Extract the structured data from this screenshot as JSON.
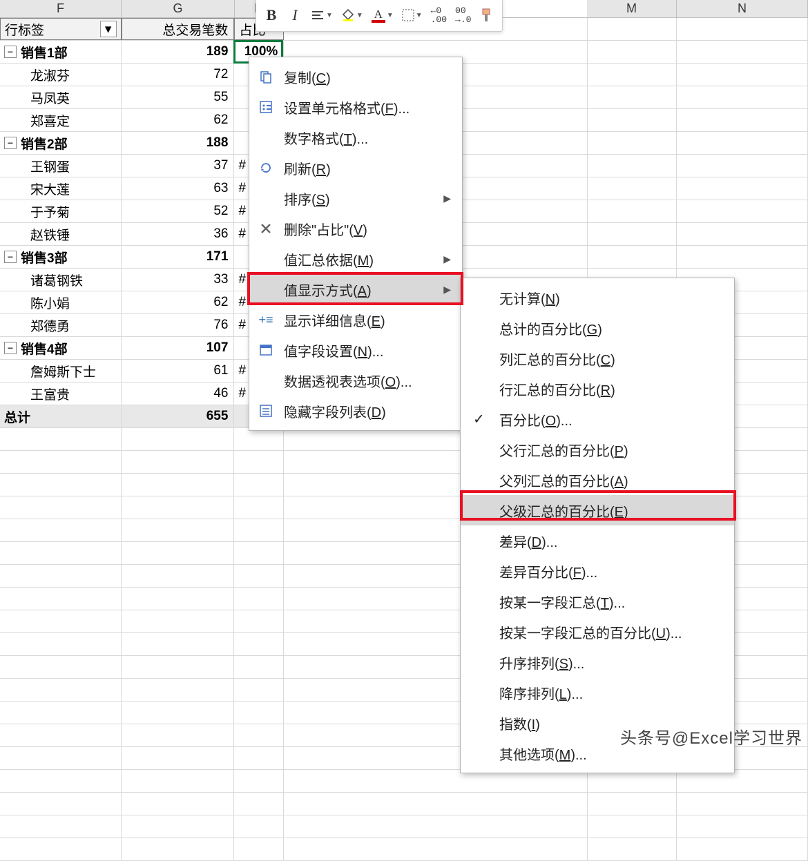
{
  "columns": [
    "F",
    "G",
    "H",
    "",
    "",
    "",
    "",
    "M",
    "N"
  ],
  "pivot": {
    "headers": {
      "rowlabel": "行标签",
      "col1": "总交易笔数",
      "col2": "占比"
    },
    "active_value": "100%",
    "groups": [
      {
        "name": "销售1部",
        "total": 189,
        "items": [
          {
            "name": "龙淑芬",
            "value": 72
          },
          {
            "name": "马凤英",
            "value": 55
          },
          {
            "name": "郑喜定",
            "value": 62
          }
        ]
      },
      {
        "name": "销售2部",
        "total": 188,
        "items": [
          {
            "name": "王钢蛋",
            "value": 37,
            "trunc": "#"
          },
          {
            "name": "宋大莲",
            "value": 63,
            "trunc": "#"
          },
          {
            "name": "于予菊",
            "value": 52,
            "trunc": "#"
          },
          {
            "name": "赵铁锤",
            "value": 36,
            "trunc": "#"
          }
        ]
      },
      {
        "name": "销售3部",
        "total": 171,
        "items": [
          {
            "name": "诸葛钢铁",
            "value": 33,
            "trunc": "#"
          },
          {
            "name": "陈小娟",
            "value": 62,
            "trunc": "#"
          },
          {
            "name": "郑德勇",
            "value": 76,
            "trunc": "#"
          }
        ]
      },
      {
        "name": "销售4部",
        "total": 107,
        "items": [
          {
            "name": "詹姆斯下士",
            "value": 61,
            "trunc": "#"
          },
          {
            "name": "王富贵",
            "value": 46,
            "trunc": "#"
          }
        ]
      }
    ],
    "grand": {
      "label": "总计",
      "value": 655
    }
  },
  "toolbar": {
    "bold": "B",
    "italic": "I"
  },
  "context_menu": {
    "copy": "复制(C)",
    "format_cells": "设置单元格格式(F)...",
    "number_format": "数字格式(T)...",
    "refresh": "刷新(R)",
    "sort": "排序(S)",
    "delete": "删除\"占比\"(V)",
    "summarize": "值汇总依据(M)",
    "show_as": "值显示方式(A)",
    "details": "显示详细信息(E)",
    "field_settings": "值字段设置(N)...",
    "pivot_options": "数据透视表选项(O)...",
    "hide_list": "隐藏字段列表(D)"
  },
  "submenu": {
    "no_calc": "无计算(N)",
    "grand_pct": "总计的百分比(G)",
    "col_pct": "列汇总的百分比(C)",
    "row_pct": "行汇总的百分比(R)",
    "pct": "百分比(O)...",
    "parent_row_pct": "父行汇总的百分比(P)",
    "parent_col_pct": "父列汇总的百分比(A)",
    "parent_pct": "父级汇总的百分比(E)",
    "diff": "差异(D)...",
    "diff_pct": "差异百分比(F)...",
    "running": "按某一字段汇总(T)...",
    "running_pct": "按某一字段汇总的百分比(U)...",
    "rank_asc": "升序排列(S)...",
    "rank_desc": "降序排列(L)...",
    "index": "指数(I)",
    "other": "其他选项(M)..."
  },
  "watermark": "头条号@Excel学习世界"
}
